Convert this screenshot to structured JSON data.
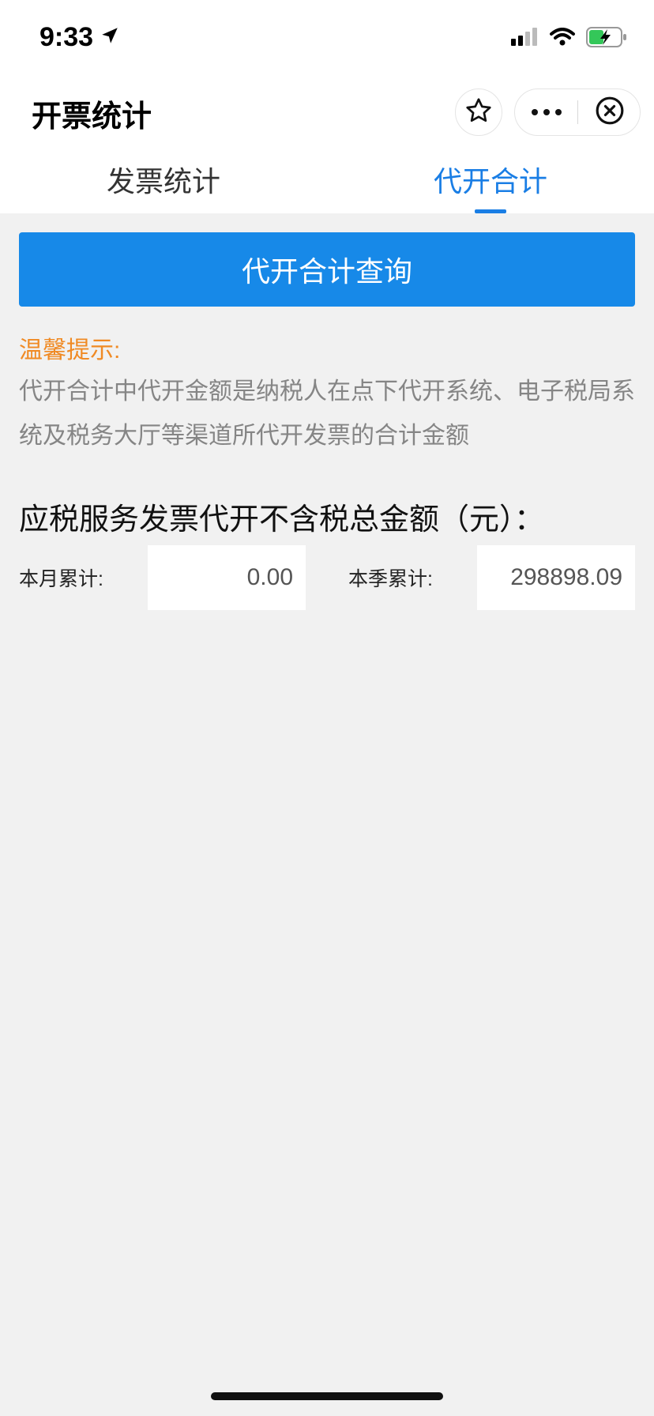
{
  "status_bar": {
    "time": "9:33",
    "icons": [
      "location-arrow-icon",
      "signal-icon",
      "wifi-icon",
      "battery-charging-icon"
    ]
  },
  "nav": {
    "title": "开票统计",
    "icons": [
      "star-icon",
      "more-dots-icon",
      "close-circle-icon"
    ]
  },
  "tabs": [
    {
      "label": "发票统计",
      "active": false
    },
    {
      "label": "代开合计",
      "active": true
    }
  ],
  "query_button": {
    "label": "代开合计查询"
  },
  "tip": {
    "title": "温馨提示:",
    "text": "代开合计中代开金额是纳税人在点下代开系统、电子税局系统及税务大厅等渠道所代开发票的合计金额"
  },
  "summary": {
    "title": "应税服务发票代开不含税总金额（元）：",
    "month_label": "本月累计:",
    "month_value": "0.00",
    "quarter_label": "本季累计:",
    "quarter_value": "298898.09"
  },
  "colors": {
    "accent": "#1a7ee5",
    "button": "#1789e8",
    "tip": "#f08a24",
    "background": "#f1f1f1"
  }
}
